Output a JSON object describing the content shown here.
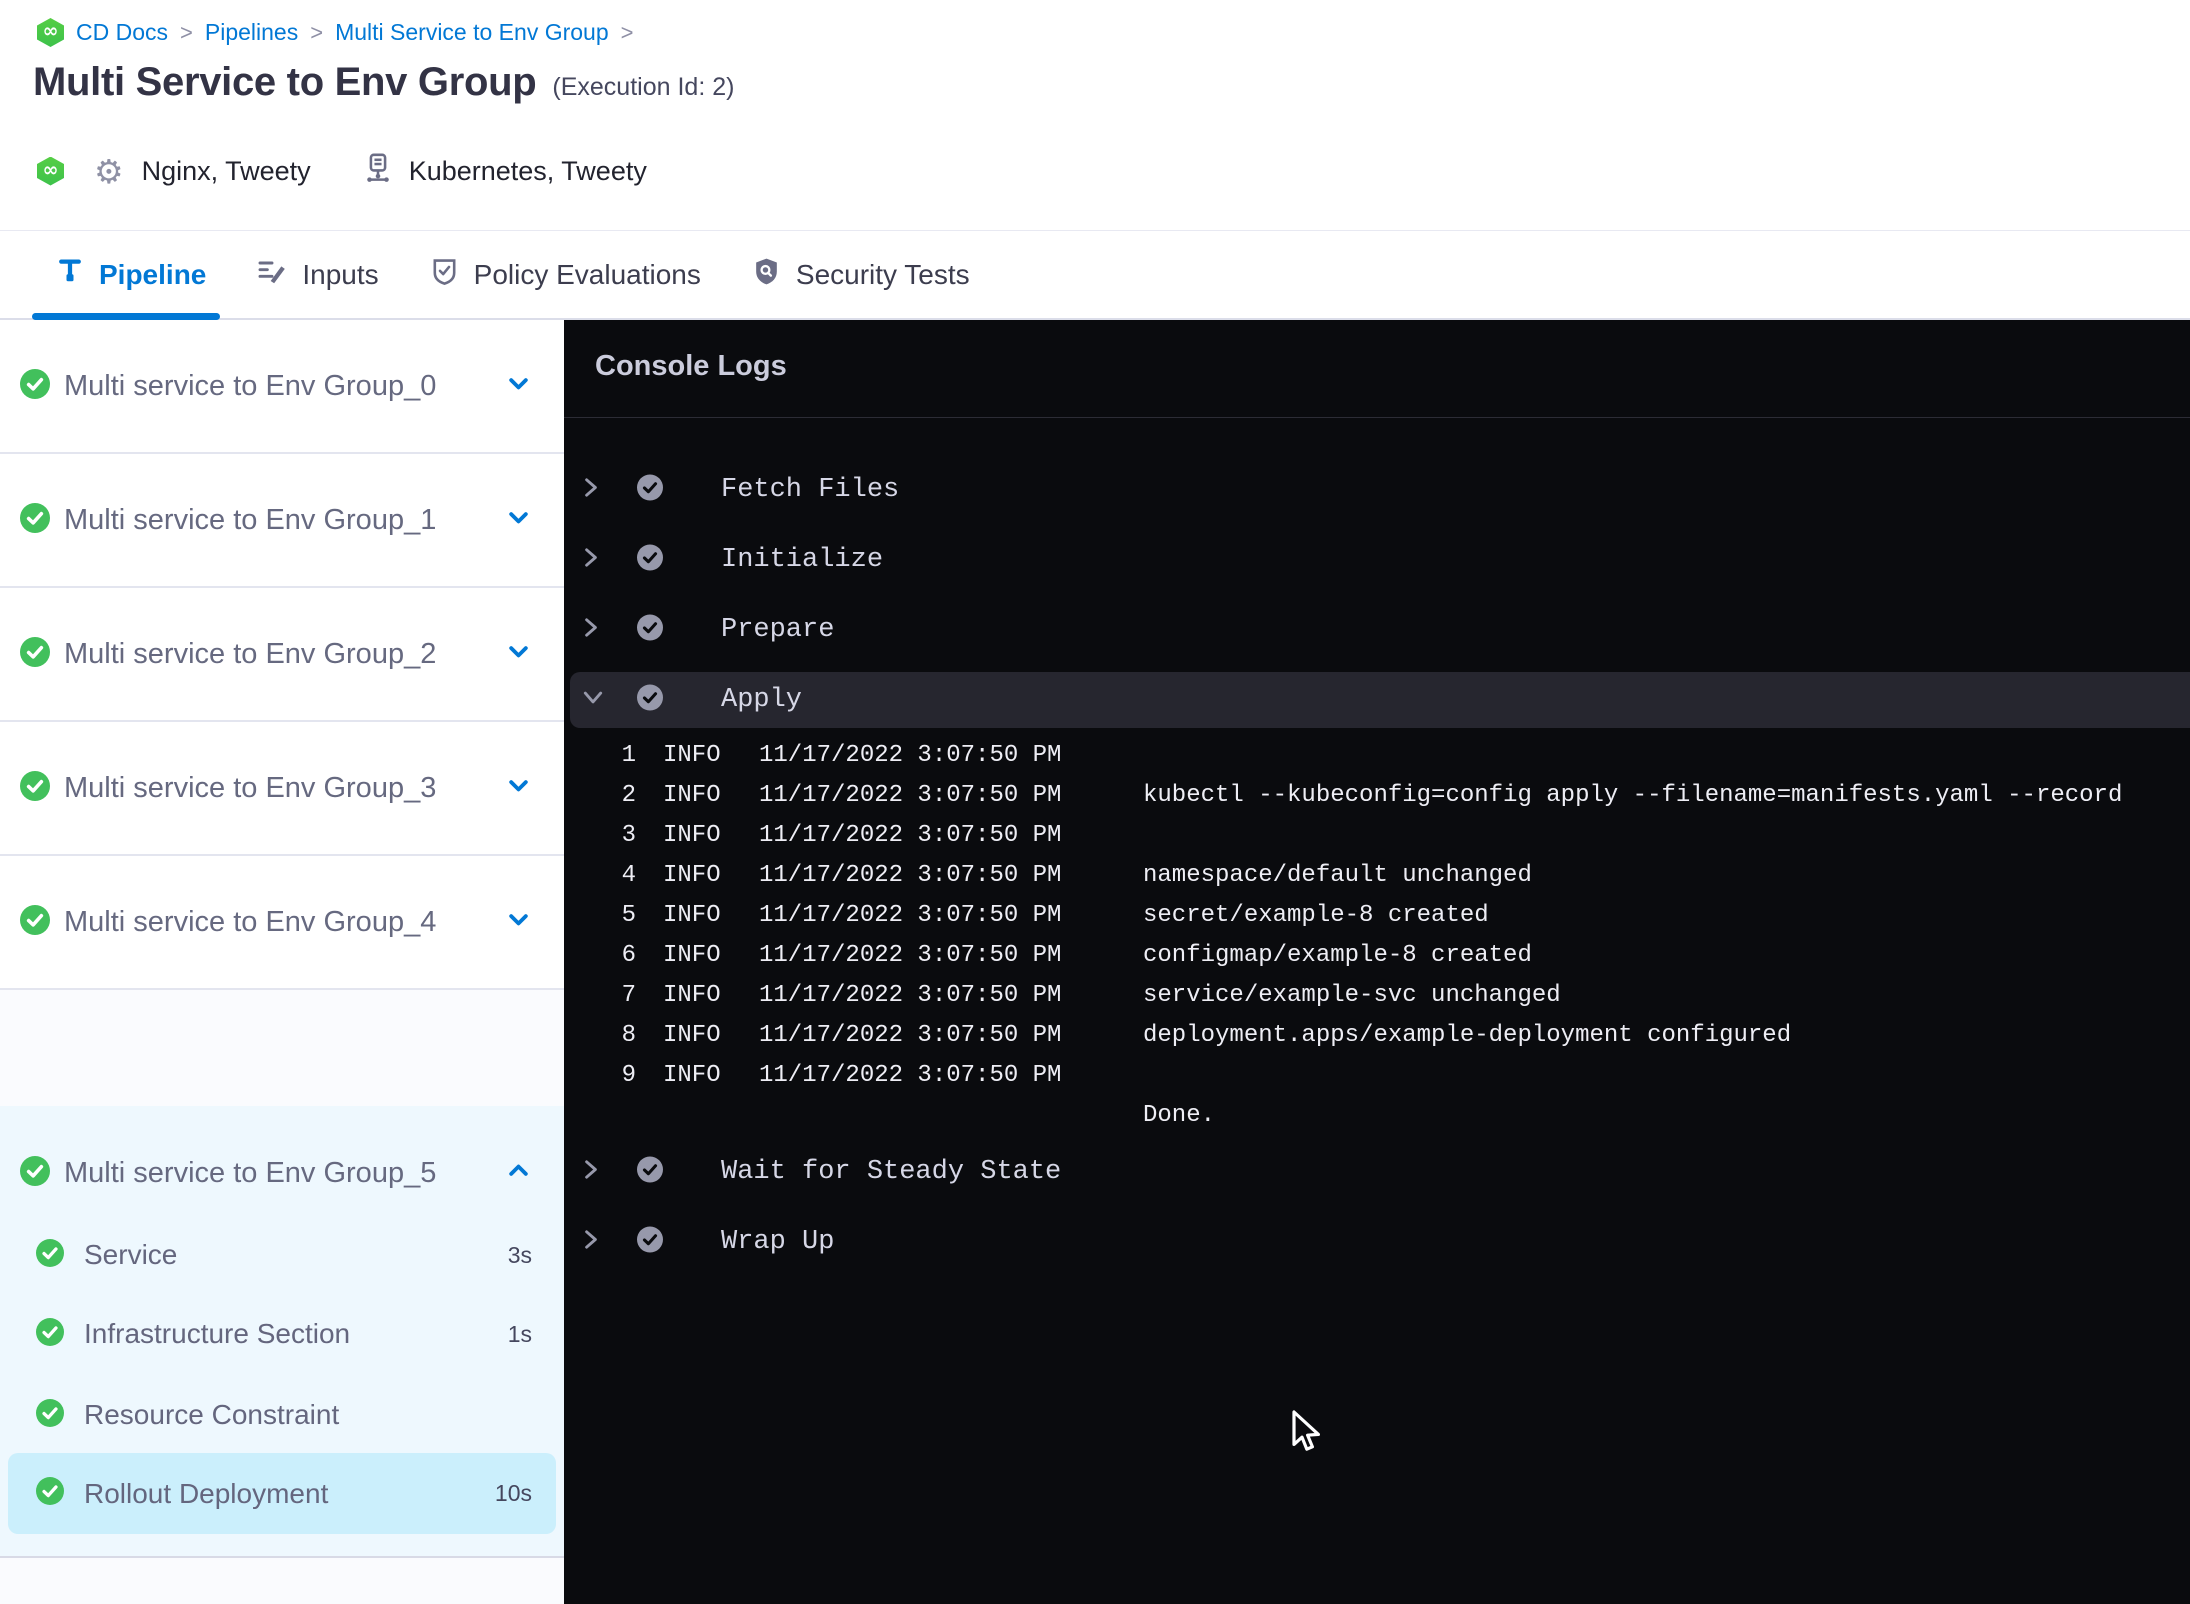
{
  "breadcrumb": {
    "items": [
      "CD Docs",
      "Pipelines",
      "Multi Service to Env Group"
    ],
    "separator": ">"
  },
  "header": {
    "title": "Multi Service to Env Group",
    "execution_label": "(Execution Id: 2)",
    "service_names": "Nginx, Tweety",
    "environment_names": "Kubernetes, Tweety",
    "logo_glyph": "∞"
  },
  "tabs": [
    {
      "label": "Pipeline",
      "active": true
    },
    {
      "label": "Inputs",
      "active": false
    },
    {
      "label": "Policy Evaluations",
      "active": false
    },
    {
      "label": "Security Tests",
      "active": false
    }
  ],
  "sidebar": {
    "stage_count": "6 stages",
    "stages": [
      {
        "name": "Multi service to Env Group_0",
        "status": "success"
      },
      {
        "name": "Multi service to Env Group_1",
        "status": "success"
      },
      {
        "name": "Multi service to Env Group_2",
        "status": "success"
      },
      {
        "name": "Multi service to Env Group_3",
        "status": "success"
      },
      {
        "name": "Multi service to Env Group_4",
        "status": "success"
      },
      {
        "name": "Multi service to Env Group_5",
        "status": "success",
        "expanded": true
      }
    ],
    "steps": [
      {
        "name": "Service",
        "duration": "3s"
      },
      {
        "name": "Infrastructure Section",
        "duration": "1s"
      },
      {
        "name": "Resource Constraint",
        "duration": ""
      },
      {
        "name": "Rollout Deployment",
        "duration": "10s",
        "selected": true
      }
    ]
  },
  "console": {
    "title": "Console Logs",
    "steps_before": [
      "Fetch Files",
      "Initialize",
      "Prepare"
    ],
    "expanded_step": "Apply",
    "steps_after": [
      "Wait for Steady State",
      "Wrap Up"
    ],
    "logs": [
      {
        "num": "1",
        "level": "INFO",
        "time": "11/17/2022 3:07:50 PM",
        "message": ""
      },
      {
        "num": "2",
        "level": "INFO",
        "time": "11/17/2022 3:07:50 PM",
        "message": "kubectl --kubeconfig=config apply --filename=manifests.yaml --record"
      },
      {
        "num": "3",
        "level": "INFO",
        "time": "11/17/2022 3:07:50 PM",
        "message": ""
      },
      {
        "num": "4",
        "level": "INFO",
        "time": "11/17/2022 3:07:50 PM",
        "message": "namespace/default unchanged"
      },
      {
        "num": "5",
        "level": "INFO",
        "time": "11/17/2022 3:07:50 PM",
        "message": "secret/example-8 created"
      },
      {
        "num": "6",
        "level": "INFO",
        "time": "11/17/2022 3:07:50 PM",
        "message": "configmap/example-8 created"
      },
      {
        "num": "7",
        "level": "INFO",
        "time": "11/17/2022 3:07:50 PM",
        "message": "service/example-svc unchanged"
      },
      {
        "num": "8",
        "level": "INFO",
        "time": "11/17/2022 3:07:50 PM",
        "message": "deployment.apps/example-deployment configured"
      },
      {
        "num": "9",
        "level": "INFO",
        "time": "11/17/2022 3:07:50 PM",
        "message": ""
      },
      {
        "num": "",
        "level": "",
        "time": "",
        "message": "Done."
      }
    ]
  },
  "colors": {
    "accent_blue": "#0278d5",
    "success_green": "#4dc263",
    "console_bg": "#0a0b0e",
    "expanded_stage_bg": "#eef8fe",
    "selected_step_bg": "#cbeffc"
  }
}
